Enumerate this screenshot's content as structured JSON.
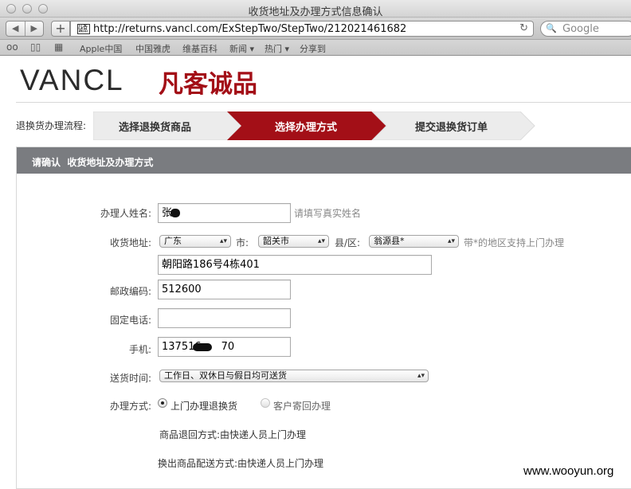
{
  "window": {
    "title": "收货地址及办理方式信息确认"
  },
  "toolbar": {
    "back_icon": "◀",
    "forward_icon": "▶",
    "new_tab_icon": "+",
    "url": "http://returns.vancl.com/ExStepTwo/StepTwo/212021461682",
    "favicon_text": "凡客诚品",
    "reload_icon": "↻",
    "search_placeholder": "Google",
    "search_icon": "🔍"
  },
  "bookmarks": {
    "items": [
      "Apple中国",
      "中国雅虎",
      "维基百科",
      "新闻 ▾",
      "热门 ▾",
      "分享到"
    ]
  },
  "logo": {
    "en": "VANCL",
    "cn": "凡客诚品"
  },
  "steps": {
    "label": "退换货办理流程:",
    "items": [
      {
        "label": "选择退换货商品",
        "active": false
      },
      {
        "label": "选择办理方式",
        "active": true
      },
      {
        "label": "提交退换货订单",
        "active": false
      }
    ],
    "colors": {
      "active": "#a30f17",
      "inactive": "#ececec"
    }
  },
  "panel": {
    "title_prefix": "请确认",
    "title": "收货地址及办理方式"
  },
  "form": {
    "name_label": "办理人姓名:",
    "name_value": "张",
    "name_hint": "请填写真实姓名",
    "address_label": "收货地址:",
    "province": "广东",
    "city_label": "市:",
    "city": "韶关市",
    "district_label": "县/区:",
    "district": "翁源县*",
    "district_hint": "带*的地区支持上门办理",
    "street": "朝阳路186号4栋401",
    "postcode_label": "邮政编码:",
    "postcode": "512600",
    "phone_label": "固定电话:",
    "phone": "",
    "mobile_label": "手机:",
    "mobile_a": "137516",
    "mobile_b": "70",
    "delivery_label": "送货时间:",
    "delivery": "工作日、双休日与假日均可送货",
    "method_label": "办理方式:",
    "method_options": [
      {
        "label": "上门办理退换货",
        "selected": true
      },
      {
        "label": "客户寄回办理",
        "selected": false
      }
    ],
    "return_info": "商品退回方式:由快递人员上门办理",
    "exchange_info": "换出商品配送方式:由快递人员上门办理"
  },
  "watermark": "www.wooyun.org"
}
